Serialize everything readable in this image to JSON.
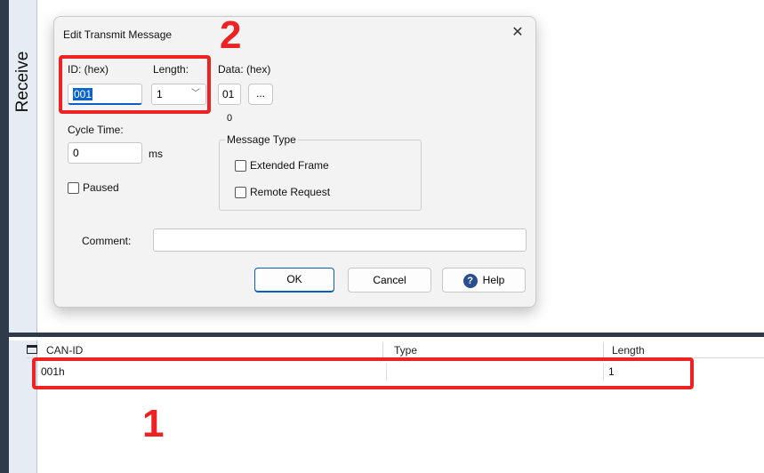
{
  "receive_panel": {
    "label": "Receive"
  },
  "dialog": {
    "title": "Edit Transmit Message",
    "close_glyph": "✕",
    "id_label": "ID: (hex)",
    "id_value": "001",
    "length_label": "Length:",
    "length_value": "1",
    "data_label": "Data: (hex)",
    "data_byte_value": "01",
    "data_byte_index": "0",
    "data_more_button": "...",
    "cycle_time_label": "Cycle Time:",
    "cycle_time_value": "0",
    "cycle_time_unit": "ms",
    "paused_label": "Paused",
    "message_type_label": "Message Type",
    "extended_frame_label": "Extended Frame",
    "remote_request_label": "Remote Request",
    "comment_label": "Comment:",
    "comment_value": "",
    "ok_button": "OK",
    "cancel_button": "Cancel",
    "help_button": "Help",
    "help_icon_glyph": "?"
  },
  "table": {
    "columns": [
      "CAN-ID",
      "Type",
      "Length"
    ],
    "rows": [
      {
        "can_id": "001h",
        "type": "",
        "length": "1"
      }
    ]
  },
  "annotations": {
    "marker_1": "1",
    "marker_2": "2",
    "color": "#ee2222"
  },
  "icons": {
    "close": "close-icon",
    "dropdown": "chevron-down-icon",
    "help": "help-icon",
    "table_header": "window-icon"
  }
}
